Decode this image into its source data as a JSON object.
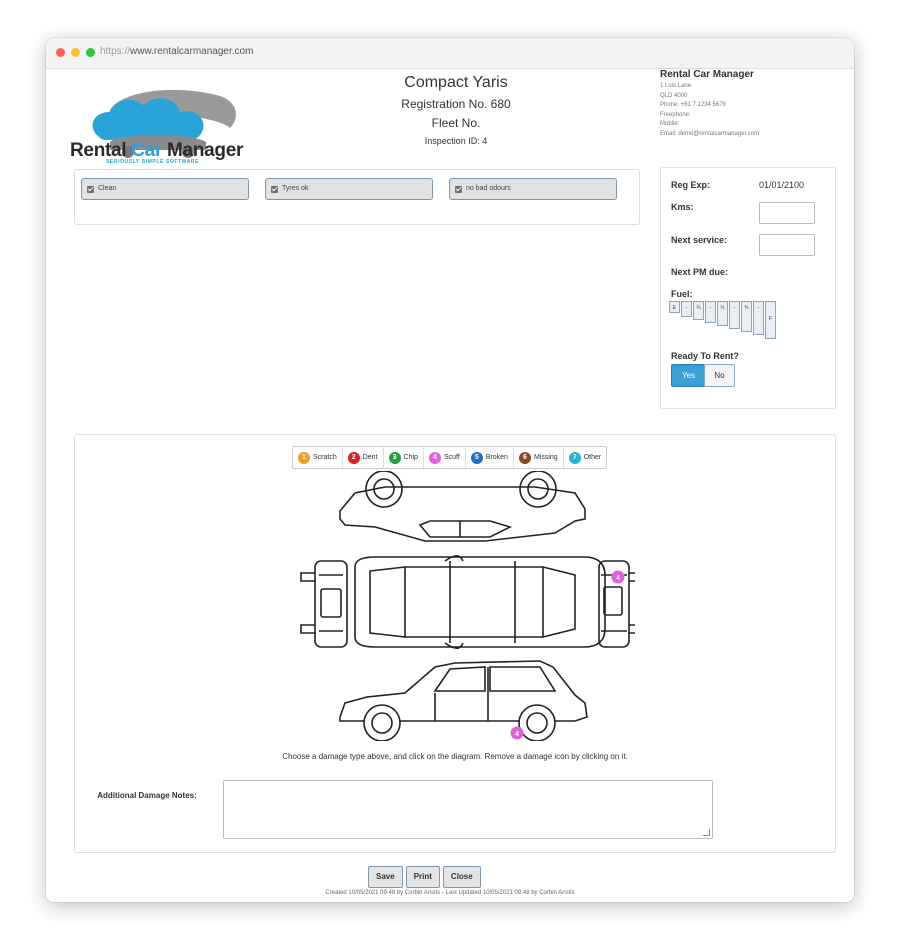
{
  "browser": {
    "url_protocol": "https://",
    "url_host": "www.rentalcarmanager.com"
  },
  "logo": {
    "word1": "Rental ",
    "word2": "Car",
    "word3": " Manager",
    "tagline": "SERIOUSLY SIMPLE SOFTWARE"
  },
  "vehicle": {
    "title": "Compact Yaris",
    "registration": "Registration No. 680",
    "fleet": "Fleet No.",
    "inspection": "Inspection ID: 4"
  },
  "company": {
    "name": "Rental Car Manager",
    "lines": [
      "1 Lois Lane",
      "QLD 4000",
      "Phone: +61 7 1234 5678",
      "Freephone:",
      "Mobile:",
      "Email: demo@rentalcarmanager.com"
    ]
  },
  "checks": [
    {
      "label": "Clean",
      "checked": true
    },
    {
      "label": "Tyres ok",
      "checked": true
    },
    {
      "label": "no bad odours",
      "checked": true
    }
  ],
  "details": {
    "reg_exp_label": "Reg Exp:",
    "reg_exp_value": "01/01/2100",
    "kms_label": "Kms:",
    "kms_value": "",
    "next_service_label": "Next service:",
    "next_service_value": "",
    "next_pm_label": "Next PM due:",
    "fuel_label": "Fuel:",
    "fuel_levels": [
      "E",
      "-",
      "¼",
      "-",
      "½",
      "-",
      "¾",
      "-",
      "F"
    ],
    "ready_label": "Ready To Rent?",
    "ready_yes": "Yes",
    "ready_no": "No",
    "ready_selected": "Yes"
  },
  "damage": {
    "legend": [
      {
        "num": "1",
        "label": "Scratch",
        "color": "#f0a020"
      },
      {
        "num": "2",
        "label": "Dent",
        "color": "#e02020"
      },
      {
        "num": "3",
        "label": "Chip",
        "color": "#20a040"
      },
      {
        "num": "4",
        "label": "Scuff",
        "color": "#e060e0"
      },
      {
        "num": "5",
        "label": "Broken",
        "color": "#2070c0"
      },
      {
        "num": "6",
        "label": "Missing",
        "color": "#8a4a20"
      },
      {
        "num": "7",
        "label": "Other",
        "color": "#20b8d8"
      }
    ],
    "markers": [
      {
        "num": "4"
      },
      {
        "num": "4"
      }
    ],
    "instructions": "Choose a damage type above, and click on the diagram. Remove a damage icon by clicking on it.",
    "notes_label": "Additional Damage Notes:",
    "notes_value": ""
  },
  "actions": {
    "save": "Save",
    "print": "Print",
    "close": "Close"
  },
  "footer": "Created 10/05/2021 09:48 by Corbin Anstis - Last Updated 10/05/2021 09:48 by Corbin Anstis",
  "colors": {
    "accent": "#2aa3d9",
    "button_blue": "#3aa0d4",
    "checkbox_bg": "#e2e2e2"
  }
}
